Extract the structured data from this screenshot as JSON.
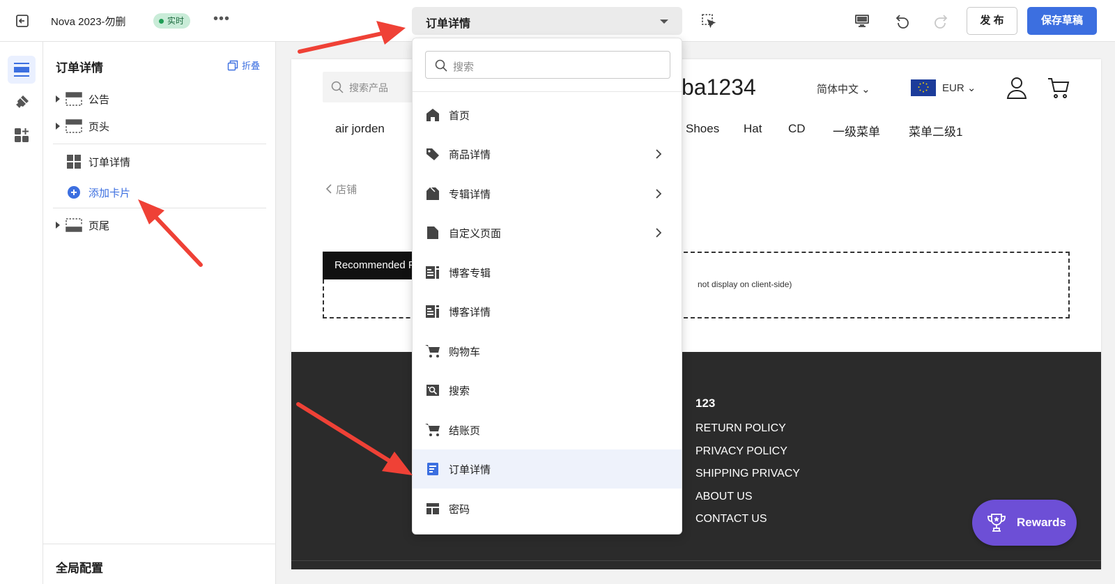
{
  "topbar": {
    "title": "Nova 2023-勿删",
    "badge": "实时",
    "more": "•••",
    "page_select": "订单详情",
    "publish": "发 布",
    "save_draft": "保存草稿"
  },
  "sidebar": {
    "title": "订单详情",
    "collapse": "折叠",
    "items": [
      {
        "label": "公告"
      },
      {
        "label": "页头"
      },
      {
        "label": "订单详情"
      },
      {
        "label": "添加卡片"
      },
      {
        "label": "页尾"
      }
    ],
    "footer": "全局配置"
  },
  "preview": {
    "search_placeholder": "搜索产品",
    "logo": "ba1234",
    "language": "简体中文",
    "currency": "EUR",
    "nav": [
      "air jorden",
      "Shoes",
      "Hat",
      "CD",
      "一级菜单",
      "菜单二级1"
    ],
    "back": "店铺",
    "section_tag": "Recommended P",
    "section_note": "not display on client-side)",
    "footer_heading": "123",
    "footer_links": [
      "RETURN POLICY",
      "PRIVACY POLICY",
      "SHIPPING PRIVACY",
      "ABOUT US",
      "CONTACT US"
    ],
    "rewards": "Rewards"
  },
  "dropdown": {
    "search_placeholder": "搜索",
    "items": [
      {
        "label": "首页",
        "icon": "home-icon",
        "submenu": false
      },
      {
        "label": "商品详情",
        "icon": "tag-icon",
        "submenu": true
      },
      {
        "label": "专辑详情",
        "icon": "collection-icon",
        "submenu": true
      },
      {
        "label": "自定义页面",
        "icon": "file-icon",
        "submenu": true
      },
      {
        "label": "博客专辑",
        "icon": "blog-icon",
        "submenu": false
      },
      {
        "label": "博客详情",
        "icon": "blog-icon",
        "submenu": false
      },
      {
        "label": "购物车",
        "icon": "cart-icon",
        "submenu": false
      },
      {
        "label": "搜索",
        "icon": "search-page-icon",
        "submenu": false
      },
      {
        "label": "结账页",
        "icon": "cart-icon",
        "submenu": false
      },
      {
        "label": "订单详情",
        "icon": "order-icon",
        "submenu": false,
        "selected": true
      },
      {
        "label": "密码",
        "icon": "password-icon",
        "submenu": false
      }
    ]
  },
  "colors": {
    "accent": "#3c6fe0",
    "badge_bg": "#c9ecd8",
    "footer_bg": "#2b2b2b",
    "rewards_bg": "#6d4fd6",
    "arrow": "#ef4136"
  }
}
